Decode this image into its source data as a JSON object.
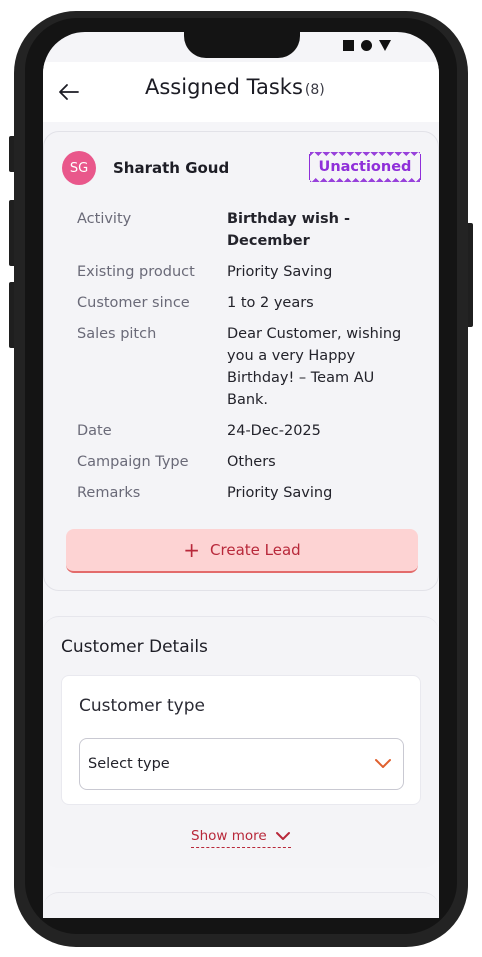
{
  "header": {
    "title": "Assigned Tasks",
    "count": "(8)",
    "back_icon": "arrow-left-icon"
  },
  "task": {
    "avatar_initials": "SG",
    "customer_name": "Sharath Goud",
    "status": "Unactioned",
    "details": [
      {
        "label": "Activity",
        "value": "Birthday wish - December"
      },
      {
        "label": "Existing product",
        "value": "Priority Saving"
      },
      {
        "label": "Customer since",
        "value": "1 to 2 years"
      },
      {
        "label": "Sales pitch",
        "value": "Dear Customer, wishing you a very Happy Birthday!  – Team AU Bank."
      },
      {
        "label": "Date",
        "value": "24-Dec-2025"
      },
      {
        "label": "Campaign Type",
        "value": "Others"
      },
      {
        "label": "Remarks",
        "value": "Priority Saving"
      }
    ],
    "create_lead_label": "Create Lead"
  },
  "customer_details": {
    "title": "Customer Details",
    "customer_type_label": "Customer type",
    "customer_type_value": "Select type",
    "show_more_label": "Show more"
  },
  "colors": {
    "accent": "#b8283a",
    "status": "#8f2fd9",
    "avatar": "#e9578b",
    "create_lead_bg": "#fdd3d3"
  }
}
